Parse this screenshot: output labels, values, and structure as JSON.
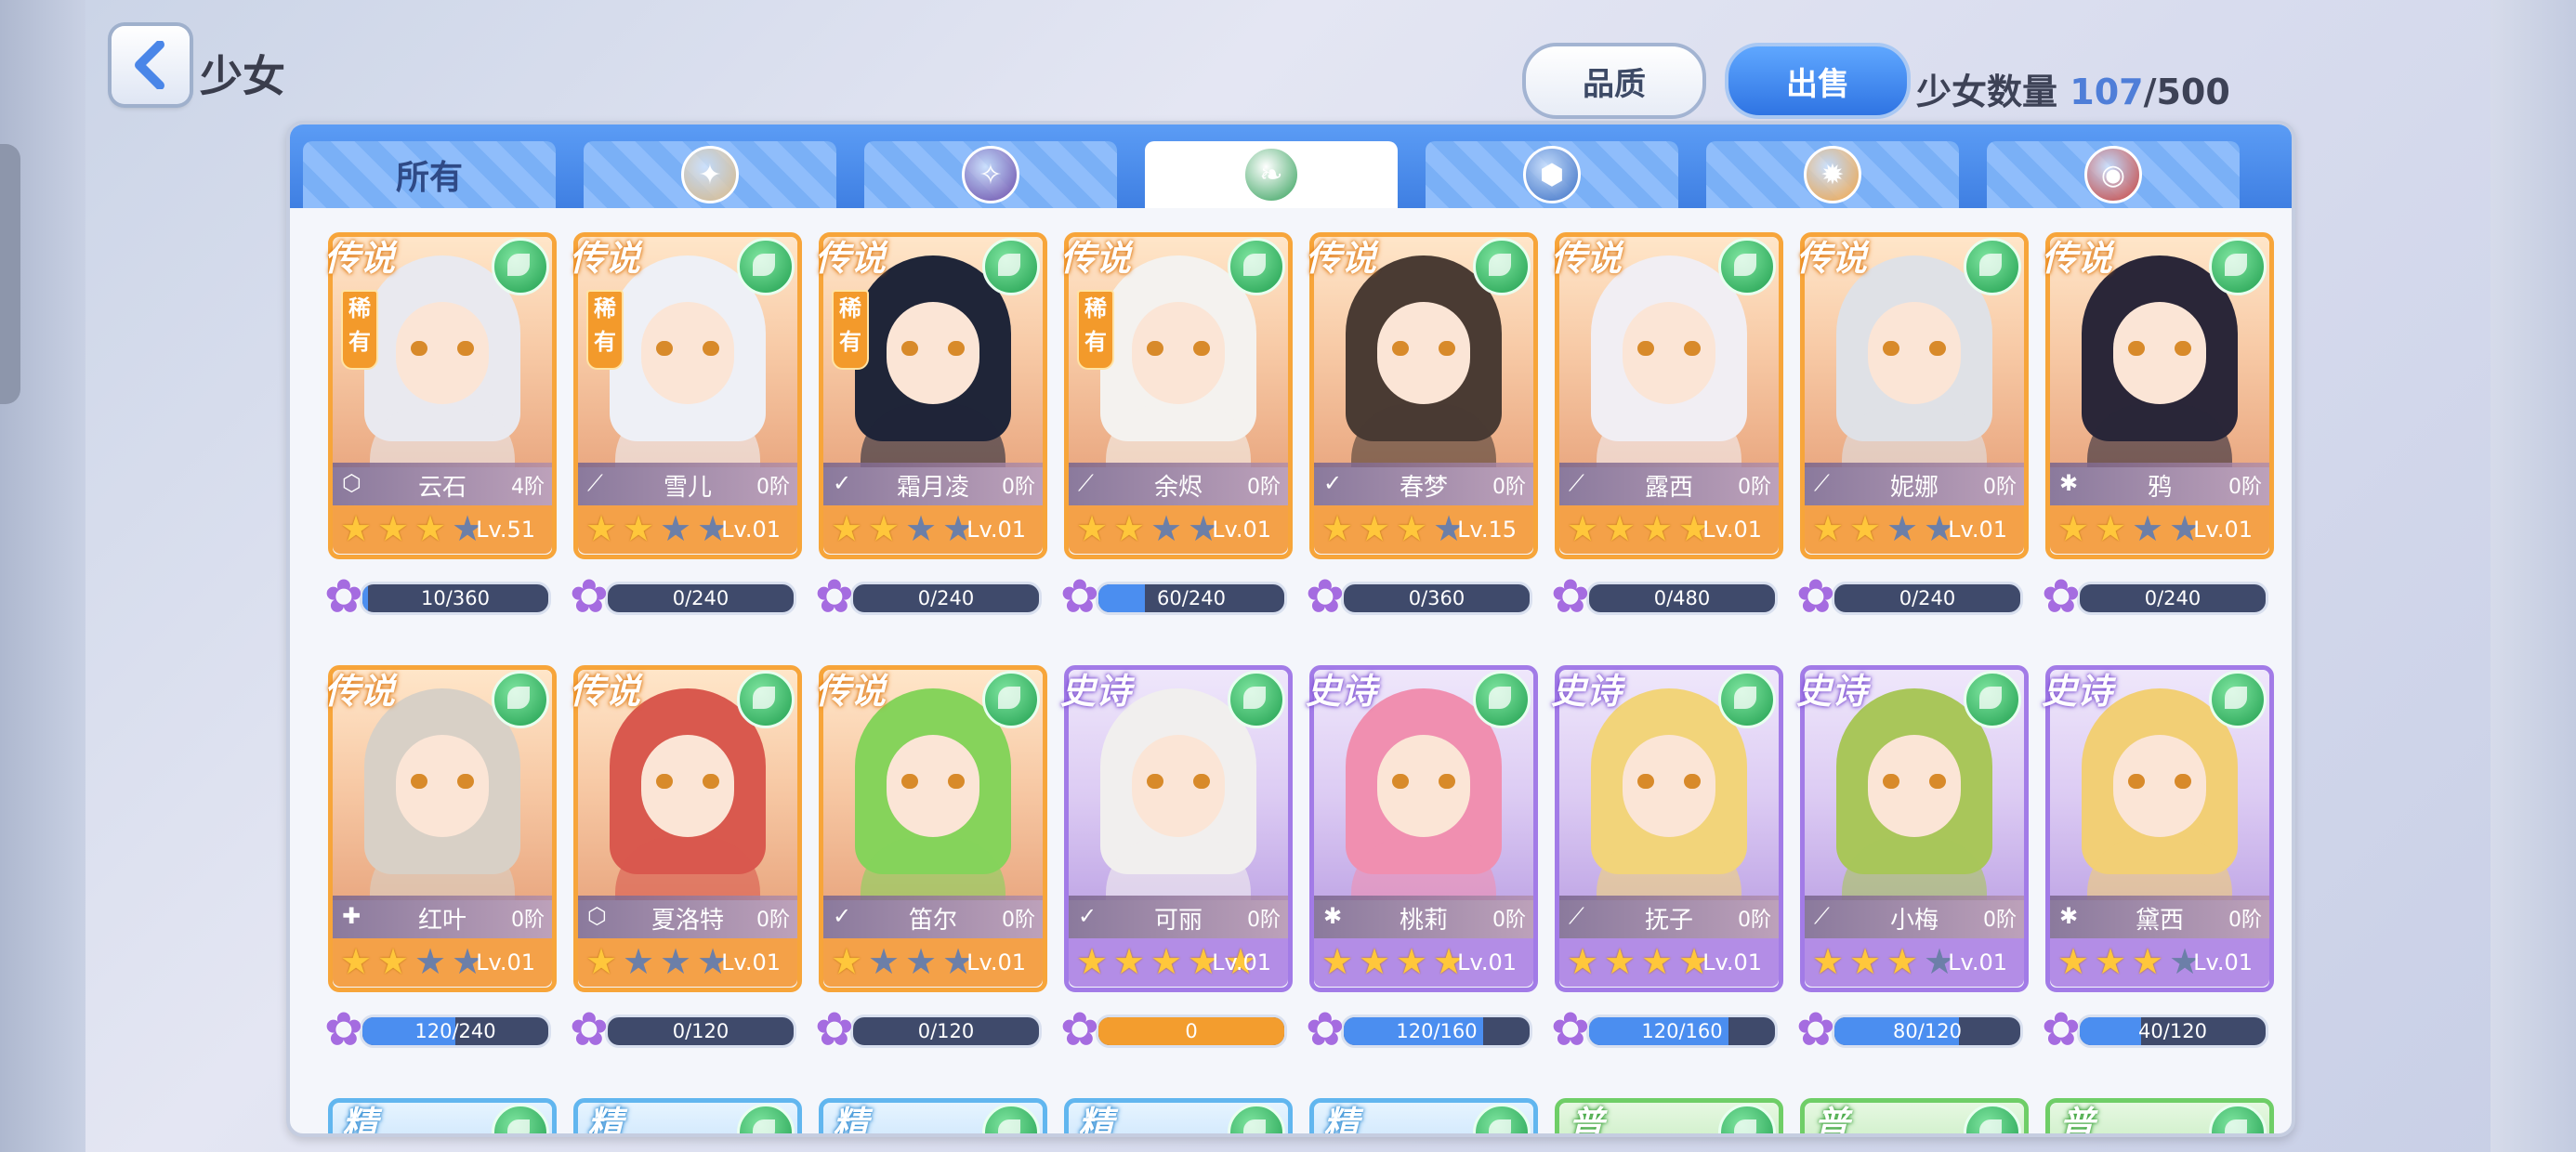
{
  "header": {
    "title": "少女",
    "quality_button": "品质",
    "sell_button": "出售",
    "count_label": "少女数量",
    "count_current": "107",
    "count_sep": "/",
    "count_max": "500"
  },
  "tabs": [
    {
      "label": "所有",
      "icon": "all"
    },
    {
      "label": "",
      "icon": "light-emblem-icon"
    },
    {
      "label": "",
      "icon": "dark-emblem-icon"
    },
    {
      "label": "",
      "icon": "wind-emblem-icon"
    },
    {
      "label": "",
      "icon": "earth-emblem-icon"
    },
    {
      "label": "",
      "icon": "sun-emblem-icon"
    },
    {
      "label": "",
      "icon": "fire-emblem-icon"
    }
  ],
  "cards": [
    {
      "rarity": "legend",
      "badge": "传说",
      "tag": "稀有",
      "name": "云石",
      "stage": "4阶",
      "stars": 3,
      "level": "Lv.51",
      "xp": "10/360",
      "xp_ratio": 0.03,
      "cls": "⬡",
      "hair": "#e9e9ef"
    },
    {
      "rarity": "legend",
      "badge": "传说",
      "tag": "稀有",
      "name": "雪儿",
      "stage": "0阶",
      "stars": 2,
      "level": "Lv.01",
      "xp": "0/240",
      "xp_ratio": 0,
      "cls": "⟋",
      "hair": "#eef0f6"
    },
    {
      "rarity": "legend",
      "badge": "传说",
      "tag": "稀有",
      "name": "霜月凌",
      "stage": "0阶",
      "stars": 2,
      "level": "Lv.01",
      "xp": "0/240",
      "xp_ratio": 0,
      "cls": "✓",
      "hair": "#1f2538"
    },
    {
      "rarity": "legend",
      "badge": "传说",
      "tag": "稀有",
      "name": "余烬",
      "stage": "0阶",
      "stars": 2,
      "level": "Lv.01",
      "xp": "60/240",
      "xp_ratio": 0.25,
      "cls": "⟋",
      "hair": "#f4f2ef"
    },
    {
      "rarity": "legend",
      "badge": "传说",
      "tag": "",
      "name": "春梦",
      "stage": "0阶",
      "stars": 3,
      "level": "Lv.15",
      "xp": "0/360",
      "xp_ratio": 0,
      "cls": "✓",
      "hair": "#4a3b33"
    },
    {
      "rarity": "legend",
      "badge": "传说",
      "tag": "",
      "name": "露西",
      "stage": "0阶",
      "stars": 4,
      "level": "Lv.01",
      "xp": "0/480",
      "xp_ratio": 0,
      "cls": "⟋",
      "hair": "#f1eef3"
    },
    {
      "rarity": "legend",
      "badge": "传说",
      "tag": "",
      "name": "妮娜",
      "stage": "0阶",
      "stars": 2,
      "level": "Lv.01",
      "xp": "0/240",
      "xp_ratio": 0,
      "cls": "⟋",
      "hair": "#dfe1e6"
    },
    {
      "rarity": "legend",
      "badge": "传说",
      "tag": "",
      "name": "鸦",
      "stage": "0阶",
      "stars": 2,
      "level": "Lv.01",
      "xp": "0/240",
      "xp_ratio": 0,
      "cls": "✱",
      "hair": "#2a2638"
    },
    {
      "rarity": "legend",
      "badge": "传说",
      "tag": "",
      "name": "红叶",
      "stage": "0阶",
      "stars": 2,
      "level": "Lv.01",
      "xp": "120/240",
      "xp_ratio": 0.5,
      "cls": "✚",
      "hair": "#d8d0c6"
    },
    {
      "rarity": "legend",
      "badge": "传说",
      "tag": "",
      "name": "夏洛特",
      "stage": "0阶",
      "stars": 1,
      "level": "Lv.01",
      "xp": "0/120",
      "xp_ratio": 0,
      "cls": "⬡",
      "hair": "#d9594e"
    },
    {
      "rarity": "legend",
      "badge": "传说",
      "tag": "",
      "name": "笛尔",
      "stage": "0阶",
      "stars": 1,
      "level": "Lv.01",
      "xp": "0/120",
      "xp_ratio": 0,
      "cls": "✓",
      "hair": "#86d35b"
    },
    {
      "rarity": "epic",
      "badge": "史诗",
      "tag": "",
      "name": "可丽",
      "stage": "0阶",
      "stars": 5,
      "level": "Lv.01",
      "xp": "0",
      "xp_ratio": 1.0,
      "xp_gold": true,
      "cls": "✓",
      "hair": "#f1efee"
    },
    {
      "rarity": "epic",
      "badge": "史诗",
      "tag": "",
      "name": "桃莉",
      "stage": "0阶",
      "stars": 4,
      "level": "Lv.01",
      "xp": "120/160",
      "xp_ratio": 0.75,
      "cls": "✱",
      "hair": "#f08fb0"
    },
    {
      "rarity": "epic",
      "badge": "史诗",
      "tag": "",
      "name": "抚子",
      "stage": "0阶",
      "stars": 4,
      "level": "Lv.01",
      "xp": "120/160",
      "xp_ratio": 0.75,
      "cls": "⟋",
      "hair": "#f2d47a"
    },
    {
      "rarity": "epic",
      "badge": "史诗",
      "tag": "",
      "name": "小梅",
      "stage": "0阶",
      "stars": 3,
      "level": "Lv.01",
      "xp": "80/120",
      "xp_ratio": 0.67,
      "cls": "⟋",
      "hair": "#a9c65a"
    },
    {
      "rarity": "epic",
      "badge": "史诗",
      "tag": "",
      "name": "黛西",
      "stage": "0阶",
      "stars": 3,
      "level": "Lv.01",
      "xp": "40/120",
      "xp_ratio": 0.33,
      "cls": "✱",
      "hair": "#f2cf75"
    }
  ],
  "peek_row": [
    {
      "rarity": "rare",
      "badge": "精"
    },
    {
      "rarity": "rare",
      "badge": "精"
    },
    {
      "rarity": "rare",
      "badge": "精"
    },
    {
      "rarity": "rare",
      "badge": "精"
    },
    {
      "rarity": "rare",
      "badge": "精"
    },
    {
      "rarity": "normal",
      "badge": "普"
    },
    {
      "rarity": "normal",
      "badge": "普"
    },
    {
      "rarity": "normal",
      "badge": "普"
    }
  ],
  "colors": {
    "legend_frame": "#f7a53a",
    "epic_frame": "#a27be7",
    "rare_frame": "#61b6ef",
    "normal_frame": "#6fce67",
    "accent_blue": "#3f7fe2"
  },
  "icons": {
    "back": "back-arrow-icon",
    "element": "wind-element-icon",
    "xp": "flower-xp-icon",
    "star": "star-icon"
  }
}
